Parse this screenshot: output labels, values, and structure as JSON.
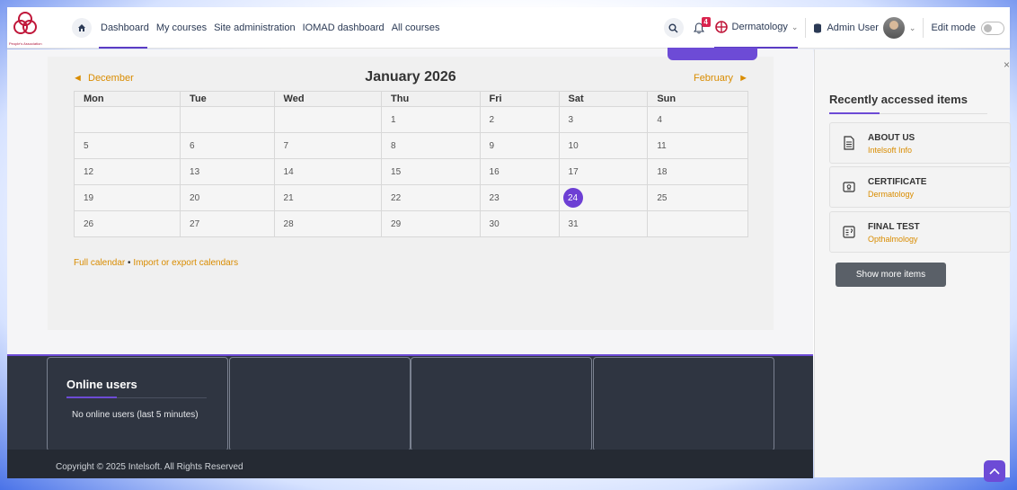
{
  "nav": {
    "org_logo_text": "People's Association",
    "links": [
      "Dashboard",
      "My courses",
      "Site administration",
      "IOMAD dashboard",
      "All courses"
    ],
    "notification_count": "4",
    "org_name": "Dermatology",
    "user_name": "Admin User",
    "edit_mode_label": "Edit mode"
  },
  "calendar": {
    "prev_month": "December",
    "next_month": "February",
    "month_title": "January 2026",
    "weekdays": [
      "Mon",
      "Tue",
      "Wed",
      "Thu",
      "Fri",
      "Sat",
      "Sun"
    ],
    "weeks": [
      [
        "",
        "",
        "",
        "1",
        "2",
        "3",
        "4"
      ],
      [
        "5",
        "6",
        "7",
        "8",
        "9",
        "10",
        "11"
      ],
      [
        "12",
        "13",
        "14",
        "15",
        "16",
        "17",
        "18"
      ],
      [
        "19",
        "20",
        "21",
        "22",
        "23",
        "24",
        "25"
      ],
      [
        "26",
        "27",
        "28",
        "29",
        "30",
        "31",
        ""
      ]
    ],
    "today": "24",
    "full_calendar_link": "Full calendar",
    "separator": "•",
    "import_export_link": "Import or export calendars"
  },
  "footer": {
    "online_users_title": "Online users",
    "online_users_text": "No online users (last 5 minutes)",
    "copyright": "Copyright © 2025 Intelsoft.  All Rights Reserved"
  },
  "drawer": {
    "title": "Recently accessed items",
    "items": [
      {
        "name": "ABOUT US",
        "course": "Intelsoft Info",
        "icon": "page-icon"
      },
      {
        "name": "CERTIFICATE",
        "course": "Dermatology",
        "icon": "certificate-icon"
      },
      {
        "name": "FINAL TEST",
        "course": "Opthalmology",
        "icon": "quiz-icon"
      }
    ],
    "show_more": "Show more items"
  },
  "colors": {
    "accent": "#6d4bd6",
    "link": "#d98c00",
    "footer_bg": "#2f3541"
  }
}
